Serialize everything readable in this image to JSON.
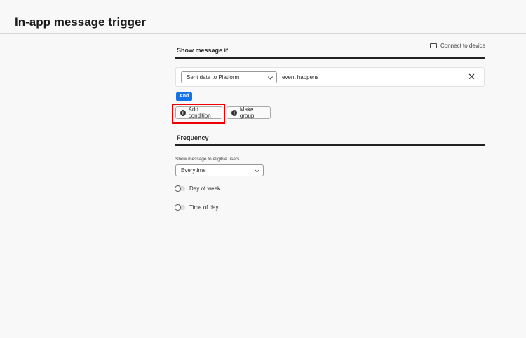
{
  "page": {
    "title": "In-app message trigger"
  },
  "trigger": {
    "section_title": "Show message if",
    "connect_label": "Connect to device",
    "condition": {
      "event_select": "Sent data to Platform",
      "suffix": "event happens"
    },
    "operator": "And",
    "add_condition": "Add condition",
    "make_group": "Make group"
  },
  "frequency": {
    "section_title": "Frequency",
    "field_label": "Show message to eligible users",
    "select_value": "Everytime",
    "toggles": [
      {
        "label": "Day of week",
        "on": false
      },
      {
        "label": "Time of day",
        "on": false
      }
    ]
  }
}
